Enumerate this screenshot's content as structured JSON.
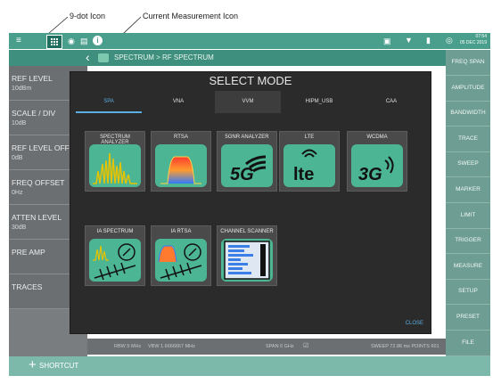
{
  "callouts": {
    "nine_dot": "9-dot Icon",
    "current_measurement": "Current Measurement Icon"
  },
  "topbar": {
    "time": "07:54",
    "date": "05 DEC 2019"
  },
  "breadcrumb": {
    "text": "SPECTRUM  >  RF SPECTRUM"
  },
  "left_panel": {
    "items": [
      {
        "label": "REF LEVEL",
        "value": "10dBm"
      },
      {
        "label": "SCALE / DIV",
        "value": "10dB"
      },
      {
        "label": "REF LEVEL OFFS",
        "value": "0dB"
      },
      {
        "label": "FREQ OFFSET",
        "value": "0Hz"
      },
      {
        "label": "ATTEN LEVEL",
        "value": "30dB"
      },
      {
        "label": "PRE AMP",
        "value": ""
      },
      {
        "label": "TRACES",
        "value": ""
      }
    ]
  },
  "right_panel": {
    "items": [
      "FREQ SPAN",
      "AMPLITUDE",
      "BANDWIDTH",
      "TRACE",
      "SWEEP",
      "MARKER",
      "LIMIT",
      "TRIGGER",
      "MEASURE",
      "SETUP",
      "PRESET",
      "FILE"
    ]
  },
  "status_line": {
    "rbw": "RBW 5 MHz",
    "vbw": "VBW 1.6666667 MHz",
    "span": "SPAN 6 GHz",
    "sweep": "SWEEP   72.86 ms   POINTS 601"
  },
  "bottom_bar": {
    "shortcut": "SHORTCUT"
  },
  "modal": {
    "title": "SELECT MODE",
    "tabs": [
      "SPA",
      "VNA",
      "VVM",
      "HIPM_USB",
      "CAA"
    ],
    "selected_tab": "SPA",
    "cards": [
      {
        "label": "SPECTRUM ANALYZER",
        "icon": "spectrum-analyzer-icon"
      },
      {
        "label": "RTSA",
        "icon": "rtsa-icon"
      },
      {
        "label": "5GNR ANALYZER",
        "icon": "5g-icon"
      },
      {
        "label": "LTE",
        "icon": "lte-icon"
      },
      {
        "label": "WCDMA",
        "icon": "3g-icon"
      },
      {
        "label": "IA SPECTRUM",
        "icon": "ia-spectrum-icon"
      },
      {
        "label": "IA RTSA",
        "icon": "ia-rtsa-icon"
      },
      {
        "label": "CHANNEL SCANNER",
        "icon": "channel-scanner-icon"
      }
    ],
    "close": "CLOSE",
    "icon_text_5g": "5G",
    "icon_text_lte": "lte",
    "icon_text_3g": "3G"
  },
  "colors": {
    "accent": "#4a9f8c",
    "tile": "#4cb593",
    "selected_tab": "#5aaee0"
  }
}
